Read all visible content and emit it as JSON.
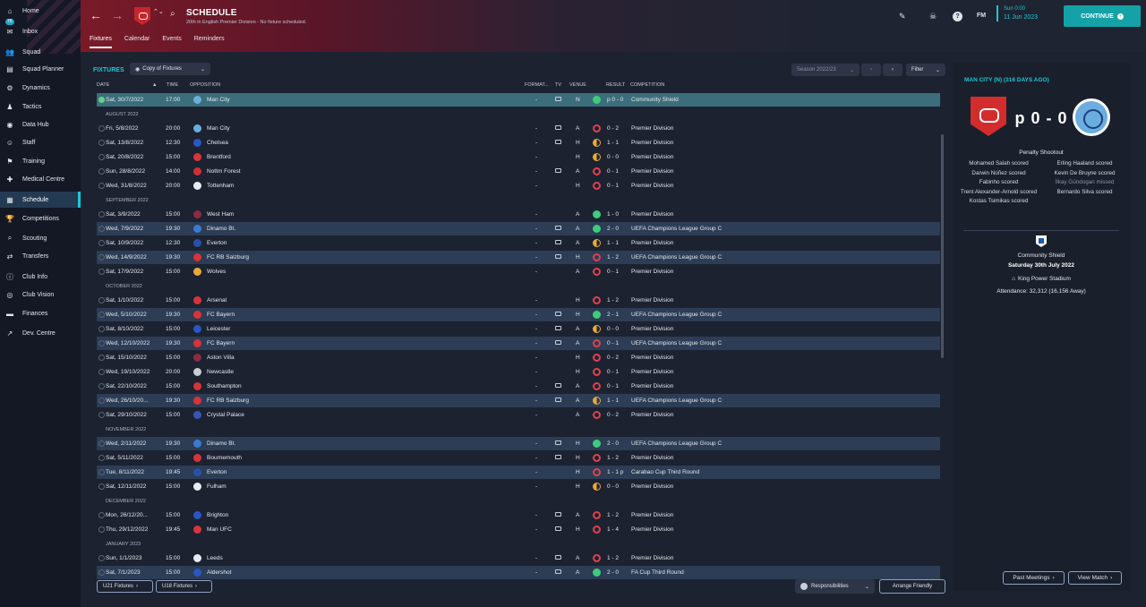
{
  "sidebar": {
    "inbox_badge": "76",
    "items": [
      {
        "label": "Home",
        "icon": "home-icon",
        "glyph": "⌂"
      },
      {
        "label": "Inbox",
        "icon": "inbox-icon",
        "glyph": "✉"
      },
      {
        "label": "Squad",
        "icon": "squad-icon",
        "glyph": "👥"
      },
      {
        "label": "Squad Planner",
        "icon": "planner-icon",
        "glyph": "▤"
      },
      {
        "label": "Dynamics",
        "icon": "dynamics-icon",
        "glyph": "⚙"
      },
      {
        "label": "Tactics",
        "icon": "tactics-icon",
        "glyph": "♟"
      },
      {
        "label": "Data Hub",
        "icon": "data-hub-icon",
        "glyph": "◉"
      },
      {
        "label": "Staff",
        "icon": "staff-icon",
        "glyph": "☺"
      },
      {
        "label": "Training",
        "icon": "training-icon",
        "glyph": "⚑"
      },
      {
        "label": "Medical Centre",
        "icon": "medical-icon",
        "glyph": "✚"
      },
      {
        "label": "Schedule",
        "icon": "schedule-icon",
        "glyph": "▦"
      },
      {
        "label": "Competitions",
        "icon": "trophy-icon",
        "glyph": "🏆"
      },
      {
        "label": "Scouting",
        "icon": "scouting-icon",
        "glyph": "⌕"
      },
      {
        "label": "Transfers",
        "icon": "transfers-icon",
        "glyph": "⇄"
      },
      {
        "label": "Club Info",
        "icon": "club-info-icon",
        "glyph": "ⓘ"
      },
      {
        "label": "Club Vision",
        "icon": "club-vision-icon",
        "glyph": "◎"
      },
      {
        "label": "Finances",
        "icon": "finances-icon",
        "glyph": "▬"
      },
      {
        "label": "Dev. Centre",
        "icon": "dev-centre-icon",
        "glyph": "↗"
      }
    ]
  },
  "header": {
    "title": "SCHEDULE",
    "subtitle": "20th in English Premier Division - No fixture scheduled.",
    "tabs": [
      "Fixtures",
      "Calendar",
      "Events",
      "Reminders"
    ],
    "fm_label": "FM",
    "date_time": "Sun 0:00",
    "date": "11 Jun 2023",
    "continue_label": "CONTINUE"
  },
  "main": {
    "section_label": "FIXTURES",
    "view_select": "Copy of Fixtures",
    "season_select": "Season 2022/23",
    "filter_label": "Filter",
    "columns": {
      "date": "DATE",
      "time": "TIME",
      "opposition": "OPPOSITION",
      "format": "FORMAT...",
      "tv": "TV",
      "venue": "VENUE",
      "result": "RESULT",
      "competition": "COMPETITION"
    },
    "rows": [
      {
        "date": "Sat, 30/7/2022",
        "time": "17:00",
        "opp": "Man City",
        "crest": "#6caddf",
        "format": "-",
        "tv": true,
        "venue": "N",
        "res": "W",
        "score": "p 0 - 0",
        "comp": "Community Shield",
        "style": "sel"
      },
      {
        "month": "AUGUST 2022"
      },
      {
        "date": "Fri, 5/8/2022",
        "time": "20:00",
        "opp": "Man City",
        "crest": "#6caddf",
        "format": "-",
        "tv": true,
        "venue": "A",
        "res": "L",
        "score": "0 - 2",
        "comp": "Premier Division"
      },
      {
        "date": "Sat, 13/8/2022",
        "time": "12:30",
        "opp": "Chelsea",
        "crest": "#2a56c6",
        "format": "-",
        "tv": true,
        "venue": "H",
        "res": "D",
        "score": "1 - 1",
        "comp": "Premier Division"
      },
      {
        "date": "Sat, 20/8/2022",
        "time": "15:00",
        "opp": "Brentford",
        "crest": "#d8343a",
        "format": "-",
        "tv": false,
        "venue": "H",
        "res": "D",
        "score": "0 - 0",
        "comp": "Premier Division"
      },
      {
        "date": "Sun, 28/8/2022",
        "time": "14:00",
        "opp": "Nottm Forest",
        "crest": "#d32f36",
        "format": "-",
        "tv": true,
        "venue": "A",
        "res": "L",
        "score": "0 - 1",
        "comp": "Premier Division"
      },
      {
        "date": "Wed, 31/8/2022",
        "time": "20:00",
        "opp": "Tottenham",
        "crest": "#e8ecf2",
        "format": "-",
        "tv": false,
        "venue": "H",
        "res": "L",
        "score": "0 - 1",
        "comp": "Premier Division"
      },
      {
        "month": "SEPTEMBER 2022"
      },
      {
        "date": "Sat, 3/9/2022",
        "time": "15:00",
        "opp": "West Ham",
        "crest": "#8a2c45",
        "format": "-",
        "tv": false,
        "venue": "A",
        "res": "W",
        "score": "1 - 0",
        "comp": "Premier Division"
      },
      {
        "date": "Wed, 7/9/2022",
        "time": "19:30",
        "opp": "Dinamo Bt.",
        "crest": "#3a7bd5",
        "format": "-",
        "tv": true,
        "venue": "A",
        "res": "W",
        "score": "2 - 0",
        "comp": "UEFA Champions League Group C",
        "style": "hl"
      },
      {
        "date": "Sat, 10/9/2022",
        "time": "12:30",
        "opp": "Everton",
        "crest": "#2950a8",
        "format": "-",
        "tv": true,
        "venue": "A",
        "res": "D",
        "score": "1 - 1",
        "comp": "Premier Division"
      },
      {
        "date": "Wed, 14/9/2022",
        "time": "19:30",
        "opp": "FC RB Salzburg",
        "crest": "#d8343a",
        "format": "-",
        "tv": true,
        "venue": "H",
        "res": "L",
        "score": "1 - 2",
        "comp": "UEFA Champions League Group C",
        "style": "hl"
      },
      {
        "date": "Sat, 17/9/2022",
        "time": "15:00",
        "opp": "Wolves",
        "crest": "#e8a93b",
        "format": "-",
        "tv": false,
        "venue": "A",
        "res": "L",
        "score": "0 - 1",
        "comp": "Premier Division"
      },
      {
        "month": "OCTOBER 2022"
      },
      {
        "date": "Sat, 1/10/2022",
        "time": "15:00",
        "opp": "Arsenal",
        "crest": "#d8343a",
        "format": "-",
        "tv": false,
        "venue": "H",
        "res": "L",
        "score": "1 - 2",
        "comp": "Premier Division"
      },
      {
        "date": "Wed, 5/10/2022",
        "time": "19:30",
        "opp": "FC Bayern",
        "crest": "#d8343a",
        "format": "-",
        "tv": true,
        "venue": "H",
        "res": "W",
        "score": "2 - 1",
        "comp": "UEFA Champions League Group C",
        "style": "hl"
      },
      {
        "date": "Sat, 8/10/2022",
        "time": "15:00",
        "opp": "Leicester",
        "crest": "#2a56c6",
        "format": "-",
        "tv": true,
        "venue": "A",
        "res": "D",
        "score": "0 - 0",
        "comp": "Premier Division"
      },
      {
        "date": "Wed, 12/10/2022",
        "time": "19:30",
        "opp": "FC Bayern",
        "crest": "#d8343a",
        "format": "-",
        "tv": true,
        "venue": "A",
        "res": "L",
        "score": "0 - 1",
        "comp": "UEFA Champions League Group C",
        "style": "hl"
      },
      {
        "date": "Sat, 15/10/2022",
        "time": "15:00",
        "opp": "Aston Villa",
        "crest": "#8a2c45",
        "format": "-",
        "tv": false,
        "venue": "H",
        "res": "L",
        "score": "0 - 2",
        "comp": "Premier Division"
      },
      {
        "date": "Wed, 19/10/2022",
        "time": "20:00",
        "opp": "Newcastle",
        "crest": "#c9ccd4",
        "format": "-",
        "tv": false,
        "venue": "H",
        "res": "L",
        "score": "0 - 1",
        "comp": "Premier Division"
      },
      {
        "date": "Sat, 22/10/2022",
        "time": "15:00",
        "opp": "Southampton",
        "crest": "#d8343a",
        "format": "-",
        "tv": true,
        "venue": "A",
        "res": "L",
        "score": "0 - 1",
        "comp": "Premier Division"
      },
      {
        "date": "Wed, 26/10/20...",
        "time": "19:30",
        "opp": "FC RB Salzburg",
        "crest": "#d8343a",
        "format": "-",
        "tv": true,
        "venue": "A",
        "res": "D",
        "score": "1 - 1",
        "comp": "UEFA Champions League Group C",
        "style": "hl"
      },
      {
        "date": "Sat, 29/10/2022",
        "time": "15:00",
        "opp": "Crystal Palace",
        "crest": "#3a55b5",
        "format": "-",
        "tv": false,
        "venue": "A",
        "res": "L",
        "score": "0 - 2",
        "comp": "Premier Division"
      },
      {
        "month": "NOVEMBER 2022"
      },
      {
        "date": "Wed, 2/11/2022",
        "time": "19:30",
        "opp": "Dinamo Bt.",
        "crest": "#3a7bd5",
        "format": "-",
        "tv": true,
        "venue": "H",
        "res": "W",
        "score": "2 - 0",
        "comp": "UEFA Champions League Group C",
        "style": "hl"
      },
      {
        "date": "Sat, 5/11/2022",
        "time": "15:00",
        "opp": "Bournemouth",
        "crest": "#d8343a",
        "format": "-",
        "tv": true,
        "venue": "H",
        "res": "L",
        "score": "1 - 2",
        "comp": "Premier Division"
      },
      {
        "date": "Tue, 8/11/2022",
        "time": "19:45",
        "opp": "Everton",
        "crest": "#2950a8",
        "format": "-",
        "tv": false,
        "venue": "H",
        "res": "L",
        "score": "1 - 1 p",
        "comp": "Carabao Cup Third Round",
        "style": "hl"
      },
      {
        "date": "Sat, 12/11/2022",
        "time": "15:00",
        "opp": "Fulham",
        "crest": "#e8ecf2",
        "format": "-",
        "tv": false,
        "venue": "H",
        "res": "D",
        "score": "0 - 0",
        "comp": "Premier Division"
      },
      {
        "month": "DECEMBER 2022"
      },
      {
        "date": "Mon, 26/12/20...",
        "time": "15:00",
        "opp": "Brighton",
        "crest": "#2a56c6",
        "format": "-",
        "tv": true,
        "venue": "A",
        "res": "L",
        "score": "1 - 2",
        "comp": "Premier Division"
      },
      {
        "date": "Thu, 29/12/2022",
        "time": "19:45",
        "opp": "Man UFC",
        "crest": "#d8343a",
        "format": "-",
        "tv": true,
        "venue": "H",
        "res": "L",
        "score": "1 - 4",
        "comp": "Premier Division"
      },
      {
        "month": "JANUARY 2023"
      },
      {
        "date": "Sun, 1/1/2023",
        "time": "15:00",
        "opp": "Leeds",
        "crest": "#e8ecf2",
        "format": "-",
        "tv": true,
        "venue": "A",
        "res": "L",
        "score": "1 - 2",
        "comp": "Premier Division"
      },
      {
        "date": "Sat, 7/1/2023",
        "time": "15:00",
        "opp": "Aldershot",
        "crest": "#2a56c6",
        "format": "-",
        "tv": true,
        "venue": "A",
        "res": "W",
        "score": "2 - 0",
        "comp": "FA Cup Third Round",
        "style": "hl"
      }
    ],
    "bottom": {
      "u21": "U21 Fixtures",
      "u18": "U18 Fixtures",
      "responsibilities": "Responsibilities",
      "arrange": "Arrange Friendly"
    }
  },
  "panel": {
    "title": "MAN CITY (N) (316 DAYS AGO)",
    "score": "p 0 - 0",
    "shootout_title": "Penalty Shootout",
    "home_takers": [
      "Mohamed Salah scored",
      "Darwin Núñez scored",
      "Fabinho scored",
      "Trent Alexander-Arnold scored",
      "Kostas Tsimikas scored"
    ],
    "away_takers": [
      "Erling Haaland scored",
      "Kevin De Bruyne scored",
      "İlkay Gündogan missed",
      "Bernardo Silva scored"
    ],
    "competition": "Community Shield",
    "match_date": "Saturday 30th July 2022",
    "stadium": "King Power Stadium",
    "attendance": "Attendance: 32,312 (16,156 Away)",
    "past_meetings": "Past Meetings",
    "view_match": "View Match"
  }
}
